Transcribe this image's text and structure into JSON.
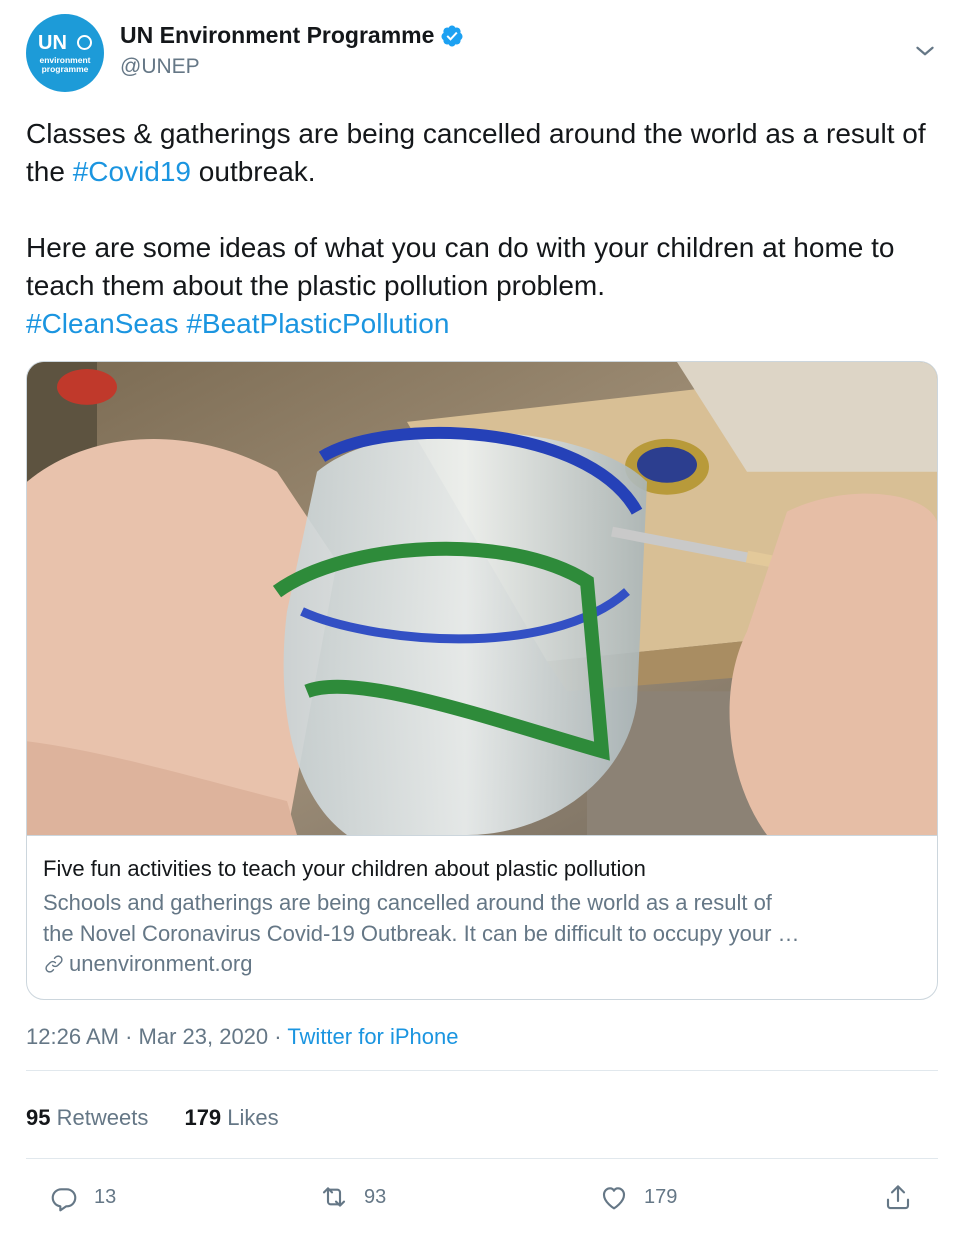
{
  "author": {
    "avatar_text": "UN",
    "avatar_sub": "environment programme",
    "name": "UN Environment Programme",
    "handle": "@UNEP",
    "verified": true,
    "brand_color": "#1d9bd8"
  },
  "tweet": {
    "line1_pre": "Classes & gatherings are being cancelled around the world as a result of the ",
    "hashtag_covid": "#Covid19",
    "line1_post": " outbreak.",
    "line2": "Here are some ideas of what you can do with your children at home to teach them about the plastic pollution problem.",
    "hashtag_cleanseas": "#CleanSeas",
    "hashtag_beatplastic": "#BeatPlasticPollution"
  },
  "card": {
    "image_icon": "photo-painted-plastic-bottle",
    "title": "Five fun activities to teach your children about plastic pollution",
    "desc_line1": "Schools and gatherings are being cancelled around the world as a result of",
    "desc_line2": "the Novel Coronavirus Covid-19 Outbreak. It can be difficult to occupy your …",
    "domain": "unenvironment.org"
  },
  "meta": {
    "time": "12:26 AM",
    "sep1": " · ",
    "date": "Mar 23, 2020",
    "sep2": " · ",
    "source": "Twitter for iPhone"
  },
  "stats": {
    "retweets_count": "95",
    "retweets_label": "Retweets",
    "likes_count": "179",
    "likes_label": "Likes"
  },
  "actions": {
    "reply_count": "13",
    "retweet_count": "93",
    "like_count": "179"
  },
  "colors": {
    "link": "#1b95e0",
    "secondary_text": "#657786",
    "border": "#ccd6dd"
  }
}
